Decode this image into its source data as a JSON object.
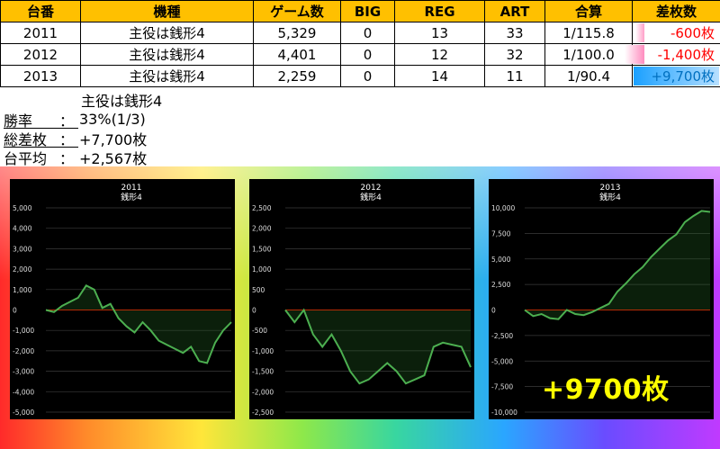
{
  "table": {
    "headers": [
      "台番",
      "機種",
      "ゲーム数",
      "BIG",
      "REG",
      "ART",
      "合算",
      "差枚数"
    ],
    "rows": [
      {
        "num": "2011",
        "model": "主役は銭形4",
        "games": "5,329",
        "big": "0",
        "reg": "13",
        "art": "33",
        "total": "1/115.8",
        "diff": "-600枚",
        "diff_value": -600
      },
      {
        "num": "2012",
        "model": "主役は銭形4",
        "games": "4,401",
        "big": "0",
        "reg": "12",
        "art": "32",
        "total": "1/100.0",
        "diff": "-1,400枚",
        "diff_value": -1400
      },
      {
        "num": "2013",
        "model": "主役は銭形4",
        "games": "2,259",
        "big": "0",
        "reg": "14",
        "art": "11",
        "total": "1/90.4",
        "diff": "+9,700枚",
        "diff_value": 9700
      }
    ],
    "colors": {
      "header": "#ffc000",
      "negative": "#ff0000",
      "positive": "#0070c0"
    }
  },
  "summary": {
    "title": "主役は銭形4",
    "win_label": "勝率",
    "win_value": "33%(1/3)",
    "total_label": "総差枚",
    "total_value": "+7,700枚",
    "avg_label": "台平均",
    "avg_value": "+2,567枚",
    "colon": "："
  },
  "overlay_label": "+9700枚",
  "chart_data": [
    {
      "type": "line",
      "title": "2011",
      "subtitle": "銭形4",
      "ylim": [
        -5000,
        5000
      ],
      "yticks": [
        5000,
        4000,
        3000,
        2000,
        1000,
        0,
        -1000,
        -2000,
        -3000,
        -4000,
        -5000
      ],
      "ytick_labels": [
        "5,000",
        "4,000",
        "3,000",
        "2,000",
        "1,000",
        "0",
        "-1,000",
        "-2,000",
        "-3,000",
        "-4,000",
        "-5,000"
      ],
      "series": [
        {
          "values": [
            0,
            -100,
            200,
            400,
            600,
            1200,
            1000,
            100,
            300,
            -400,
            -800,
            -1100,
            -600,
            -1000,
            -1500,
            -1700,
            -1900,
            -2100,
            -1800,
            -2500,
            -2600,
            -1600,
            -1000,
            -600
          ]
        }
      ]
    },
    {
      "type": "line",
      "title": "2012",
      "subtitle": "銭形4",
      "ylim": [
        -2500,
        2500
      ],
      "yticks": [
        2500,
        2000,
        1500,
        1000,
        500,
        0,
        -500,
        -1000,
        -1500,
        -2000,
        -2500
      ],
      "ytick_labels": [
        "2,500",
        "2,000",
        "1,500",
        "1,000",
        "500",
        "0",
        "-500",
        "-1,000",
        "-1,500",
        "-2,000",
        "-2,500"
      ],
      "series": [
        {
          "values": [
            0,
            -300,
            0,
            -600,
            -900,
            -600,
            -1000,
            -1500,
            -1800,
            -1700,
            -1500,
            -1300,
            -1500,
            -1800,
            -1700,
            -1600,
            -900,
            -800,
            -850,
            -900,
            -1400
          ]
        }
      ]
    },
    {
      "type": "line",
      "title": "2013",
      "subtitle": "銭形4",
      "ylim": [
        -10000,
        10000
      ],
      "yticks": [
        10000,
        7500,
        5000,
        2500,
        0,
        -2500,
        -5000,
        -7500,
        -10000
      ],
      "ytick_labels": [
        "10,000",
        "7,500",
        "5,000",
        "2,500",
        "0",
        "-2,500",
        "-5,000",
        "-7,500",
        "-10,000"
      ],
      "series": [
        {
          "values": [
            0,
            -600,
            -400,
            -800,
            -900,
            0,
            -400,
            -500,
            -200,
            200,
            600,
            1800,
            2600,
            3500,
            4200,
            5200,
            6000,
            6800,
            7400,
            8600,
            9200,
            9700,
            9600
          ]
        }
      ]
    }
  ]
}
